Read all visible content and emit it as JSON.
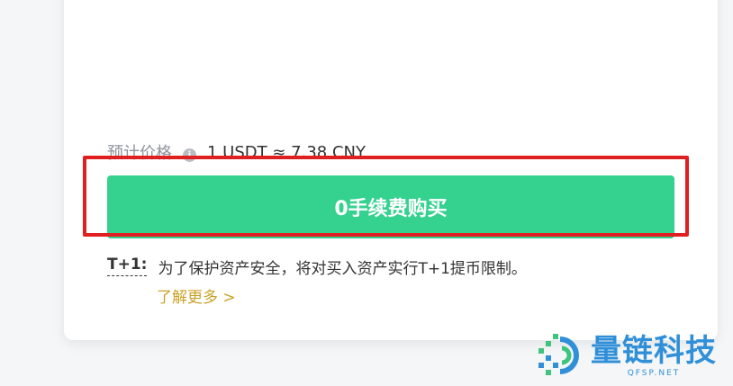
{
  "price": {
    "label": "预计价格",
    "value": "1 USDT ≈ 7.38 CNY"
  },
  "buy_button": {
    "label": "0手续费购买"
  },
  "notice": {
    "label": "T+1:",
    "text": "为了保护资产安全，将对买入资产实行T+1提币限制。",
    "link": "了解更多 >"
  },
  "watermark": {
    "name_cn": "量链科技",
    "name_en": "QFSP.NET"
  },
  "colors": {
    "accent": "#35d18f",
    "highlight": "#e02020",
    "link": "#c9a227",
    "watermark": "#2f8fd8"
  }
}
